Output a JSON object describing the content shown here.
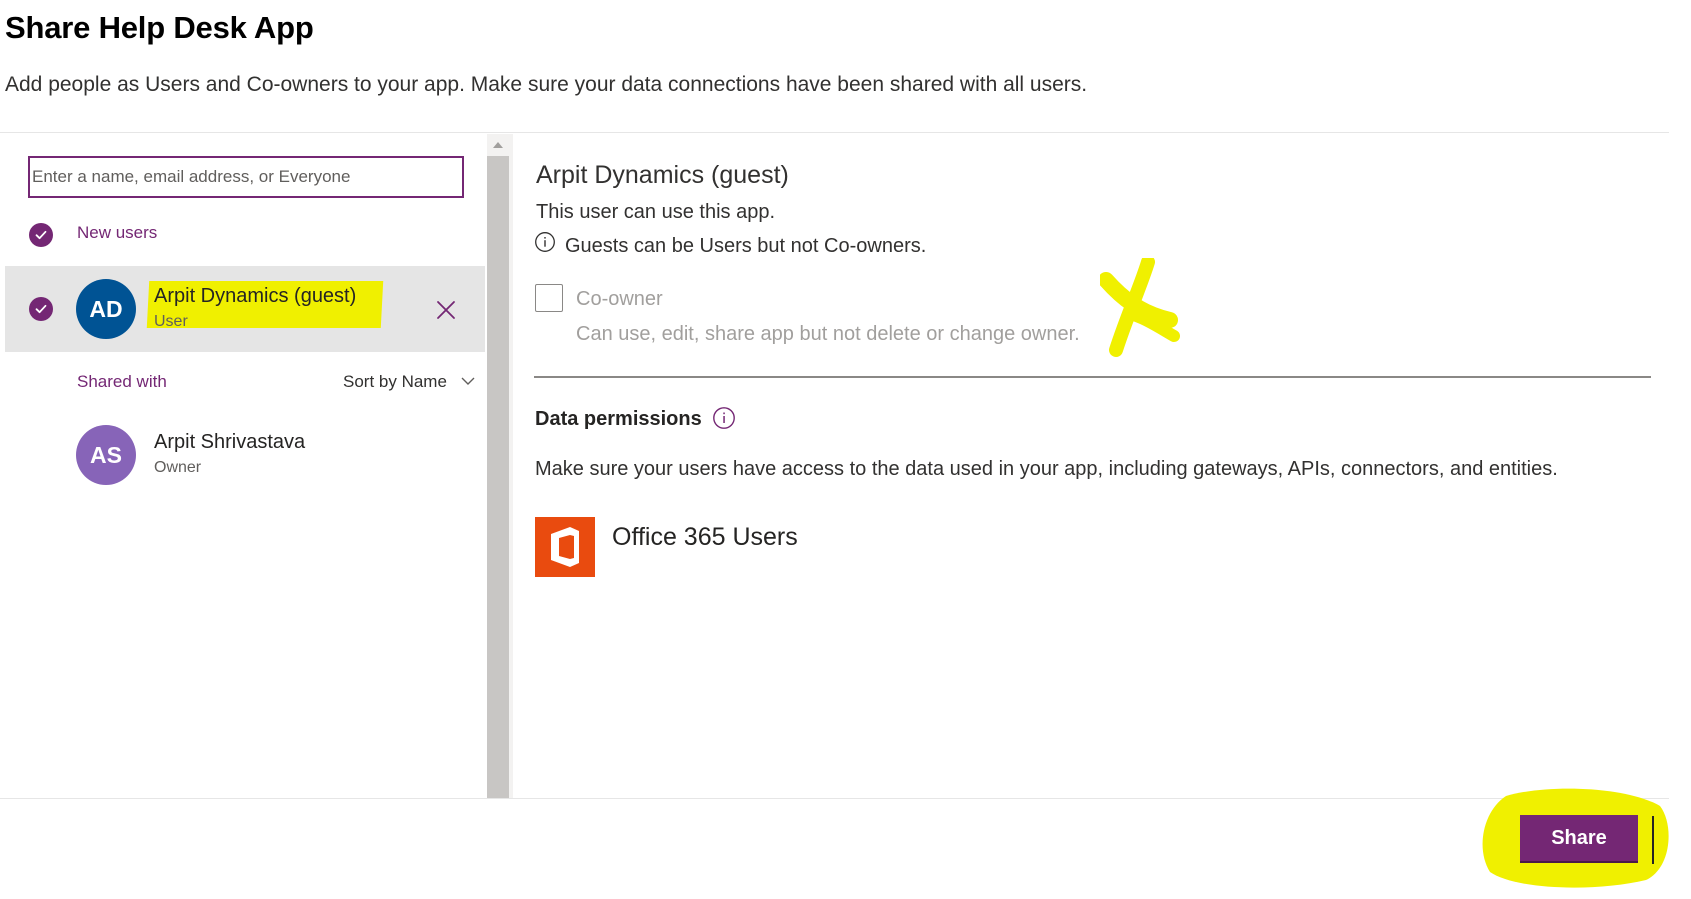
{
  "dialog": {
    "title": "Share Help Desk App",
    "subtitle": "Add people as Users and Co-owners to your app. Make sure your data connections have been shared with all users."
  },
  "search": {
    "placeholder": "Enter a name, email address, or Everyone",
    "value": ""
  },
  "new_users": {
    "label": "New users",
    "items": [
      {
        "initials": "AD",
        "name": "Arpit Dynamics (guest)",
        "role": "User",
        "avatar_color": "#005394",
        "selected": true
      }
    ]
  },
  "shared_with": {
    "label": "Shared with",
    "sort_label": "Sort by Name",
    "items": [
      {
        "initials": "AS",
        "name": "Arpit Shrivastava",
        "role": "Owner",
        "avatar_color": "#8764b8"
      }
    ]
  },
  "details": {
    "name": "Arpit Dynamics (guest)",
    "description": "This user can use this app.",
    "guest_note": "Guests can be Users but not Co-owners.",
    "coowner": {
      "label": "Co-owner",
      "description": "Can use, edit, share app but not delete or change owner.",
      "checked": false,
      "disabled": true
    }
  },
  "data_permissions": {
    "title": "Data permissions",
    "description": "Make sure your users have access to the data used in your app, including gateways, APIs, connectors, and entities.",
    "connections": [
      {
        "name": "Office 365 Users",
        "icon": "office-365-icon",
        "color": "#e94b0f"
      }
    ]
  },
  "footer": {
    "share_label": "Share"
  },
  "colors": {
    "accent": "#742774",
    "highlight": "#f0f000"
  }
}
